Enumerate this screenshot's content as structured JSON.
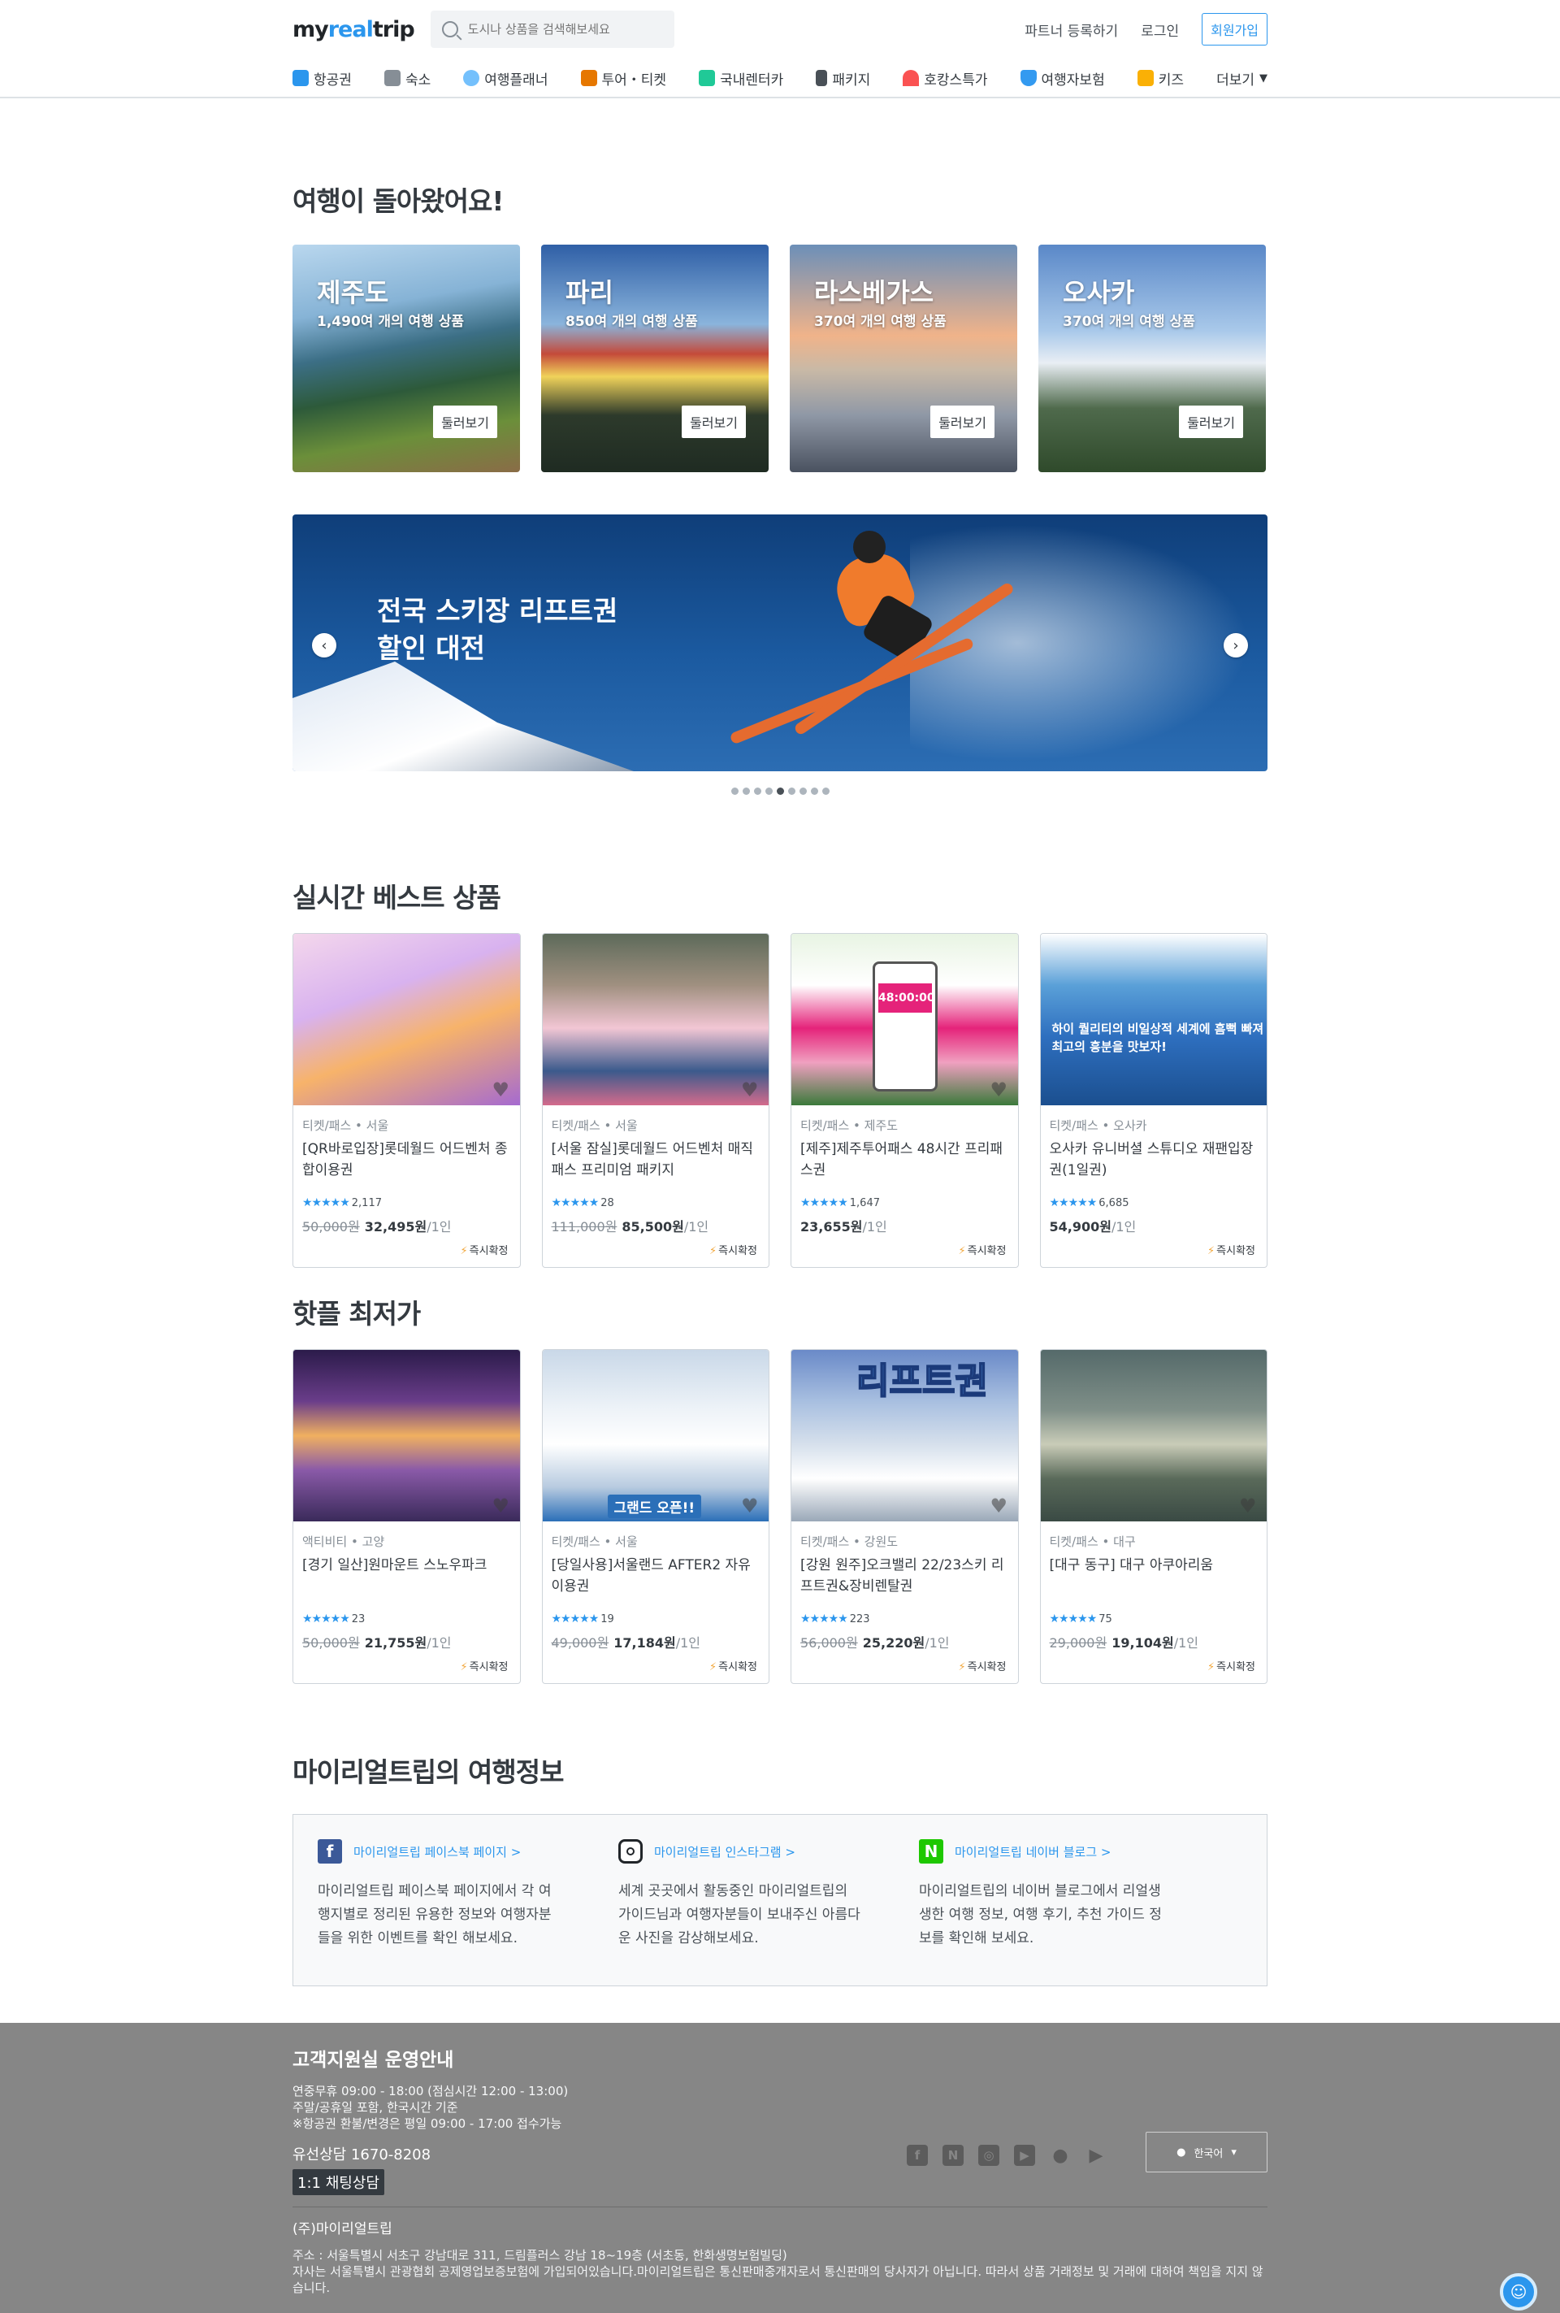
{
  "header": {
    "logo_prefix": "my",
    "logo_mid": "real",
    "logo_suffix": "trip",
    "search_placeholder": "도시나 상품을 검색해보세요",
    "partner": "파트너 등록하기",
    "login": "로그인",
    "signup": "회원가입"
  },
  "nav": {
    "items": [
      {
        "label": "항공권",
        "icon": "airplane-icon",
        "color": "#2b96ed"
      },
      {
        "label": "숙소",
        "icon": "building-icon",
        "color": "#868e96"
      },
      {
        "label": "여행플래너",
        "icon": "planner-icon",
        "color": "#74c0fc"
      },
      {
        "label": "투어・티켓",
        "icon": "ticket-icon",
        "color": "#e67700"
      },
      {
        "label": "국내렌터카",
        "icon": "car-icon",
        "color": "#20c997"
      },
      {
        "label": "패키지",
        "icon": "suitcase-icon",
        "color": "#495057"
      },
      {
        "label": "호캉스특가",
        "icon": "sun-icon",
        "color": "#fa5252"
      },
      {
        "label": "여행자보험",
        "icon": "shield-icon",
        "color": "#339af0"
      },
      {
        "label": "키즈",
        "icon": "kids-icon",
        "color": "#fab005"
      }
    ],
    "more": "더보기"
  },
  "destinations": {
    "title": "여행이 돌아왔어요!",
    "cards": [
      {
        "name": "제주도",
        "count": "1,490여 개의 여행 상품",
        "button": "둘러보기"
      },
      {
        "name": "파리",
        "count": "850여 개의 여행 상품",
        "button": "둘러보기"
      },
      {
        "name": "라스베가스",
        "count": "370여 개의 여행 상품",
        "button": "둘러보기"
      },
      {
        "name": "오사카",
        "count": "370여 개의 여행 상품",
        "button": "둘러보기"
      }
    ]
  },
  "banner": {
    "title": "전국 스키장 리프트권\n할인 대전",
    "dots_total": 9,
    "dots_active": 5
  },
  "best": {
    "title": "실시간 베스트 상품",
    "items": [
      {
        "cat": "티켓/패스 • 서울",
        "name": "[QR바로입장]롯데월드 어드벤처 종합이용권",
        "reviews": "2,117",
        "orig": "50,000원",
        "price": "32,495원",
        "unit": "/1인",
        "instant": "즉시확정"
      },
      {
        "cat": "티켓/패스 • 서울",
        "name": "[서울 잠실]롯데월드 어드벤처 매직패스 프리미엄 패키지",
        "reviews": "28",
        "orig": "111,000원",
        "price": "85,500원",
        "unit": "/1인",
        "instant": "즉시확정"
      },
      {
        "cat": "티켓/패스 • 제주도",
        "name": "[제주]제주투어패스 48시간 프리패스권",
        "reviews": "1,647",
        "orig": "",
        "price": "23,655원",
        "unit": "/1인",
        "instant": "즉시확정",
        "timer": "48:00:00"
      },
      {
        "cat": "티켓/패스 • 오사카",
        "name": "오사카 유니버셜 스튜디오 재팬입장권(1일권)",
        "reviews": "6,685",
        "orig": "",
        "price": "54,900원",
        "unit": "/1인",
        "instant": "즉시확정",
        "caption": "하이 퀄리티의 비일상적 세계에 흠뻑 빠져\n최고의 흥분을 맛보자!"
      }
    ]
  },
  "hot": {
    "title": "핫플 최저가",
    "items": [
      {
        "cat": "액티비티 • 고양",
        "name": "[경기 일산]원마운트 스노우파크",
        "reviews": "23",
        "orig": "50,000원",
        "price": "21,755원",
        "unit": "/1인",
        "instant": "즉시확정"
      },
      {
        "cat": "티켓/패스 • 서울",
        "name": "[당일사용]서울랜드 AFTER2 자유이용권",
        "reviews": "19",
        "orig": "49,000원",
        "price": "17,184원",
        "unit": "/1인",
        "instant": "즉시확정",
        "ribbon": "그랜드 오픈!!"
      },
      {
        "cat": "티켓/패스 • 강원도",
        "name": "[강원 원주]오크밸리 22/23스키 리프트권&장비렌탈권",
        "reviews": "223",
        "orig": "56,000원",
        "price": "25,220원",
        "unit": "/1인",
        "instant": "즉시확정",
        "big": "리프트권"
      },
      {
        "cat": "티켓/패스 • 대구",
        "name": "[대구 동구] 대구 아쿠아리움",
        "reviews": "75",
        "orig": "29,000원",
        "price": "19,104원",
        "unit": "/1인",
        "instant": "즉시확정"
      }
    ]
  },
  "info": {
    "title": "마이리얼트립의 여행정보",
    "cols": [
      {
        "head": "마이리얼트립 페이스북 페이지 >",
        "text": "마이리얼트립 페이스북 페이지에서 각 여행지별로 정리된 유용한 정보와 여행자분들을 위한 이벤트를 확인 해보세요."
      },
      {
        "head": "마이리얼트립 인스타그램 >",
        "text": "세계 곳곳에서 활동중인 마이리얼트립의 가이드님과 여행자분들이 보내주신 아름다운 사진을 감상해보세요."
      },
      {
        "head": "마이리얼트립 네이버 블로그 >",
        "text": "마이리얼트립의 네이버 블로그에서 리얼생생한 여행 정보, 여행 후기, 추천 가이드 정보를 확인해 보세요."
      }
    ]
  },
  "footer": {
    "title": "고객지원실 운영안내",
    "hours1": "연중무휴 09:00 - 18:00 (점심시간 12:00 - 13:00)",
    "hours2": "주말/공휴일 포함, 한국시간 기준",
    "hours3": "※항공권 환불/변경은 평일 09:00 - 17:00 접수가능",
    "phone": "유선상담 1670-8208",
    "chat": "1:1 채팅상담",
    "company": "(주)마이리얼트립",
    "addr1": "주소 : 서울특별시 서초구 강남대로 311, 드림플러스 강남 18~19층 (서초동, 한화생명보험빌딩)",
    "addr2": "자사는 서울특별시 관광협회 공제영업보증보험에 가입되어있습니다.마이리얼트립은 통신판매중개자로서 통신판매의 당사자가 아닙니다. 따라서 상품 거래정보 및 거래에 대하여 책임을 지지 않습니다.",
    "language": "한국어"
  }
}
